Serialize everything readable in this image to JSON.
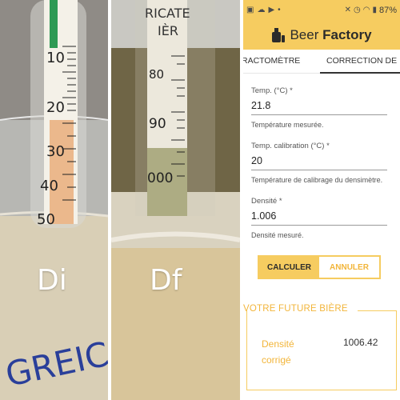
{
  "photos": {
    "left_label": "Di",
    "right_label": "Df",
    "left_scale": [
      "10",
      "20",
      "30",
      "40",
      "50"
    ],
    "right_scale": [
      "80",
      "90",
      "000"
    ],
    "right_top_text": "RICATE",
    "right_top_text2": "IÈR",
    "bottom_text": "GREIC"
  },
  "statusbar": {
    "battery": "87%"
  },
  "app": {
    "title_light": "Beer",
    "title_bold": "Factory"
  },
  "tabs": [
    {
      "label": "RACTOMÈTRE",
      "selected": false
    },
    {
      "label": "CORRECTION DE",
      "selected": true
    }
  ],
  "form": {
    "temp": {
      "label": "Temp. (°C) *",
      "value": "21.8",
      "help": "Température mesurée."
    },
    "temp_cal": {
      "label": "Temp. calibration (°C) *",
      "value": "20",
      "help": "Température de calibrage du densimètre."
    },
    "density": {
      "label": "Densité *",
      "value": "1.006",
      "help": "Densité mesuré."
    }
  },
  "buttons": {
    "calc": "CALCULER",
    "cancel": "ANNULER"
  },
  "result": {
    "title": "VOTRE FUTURE BIÈRE",
    "label": "Densité corrigé",
    "value": "1006.42"
  },
  "colors": {
    "accent": "#f6cc60",
    "accent_text": "#f2b53a"
  }
}
